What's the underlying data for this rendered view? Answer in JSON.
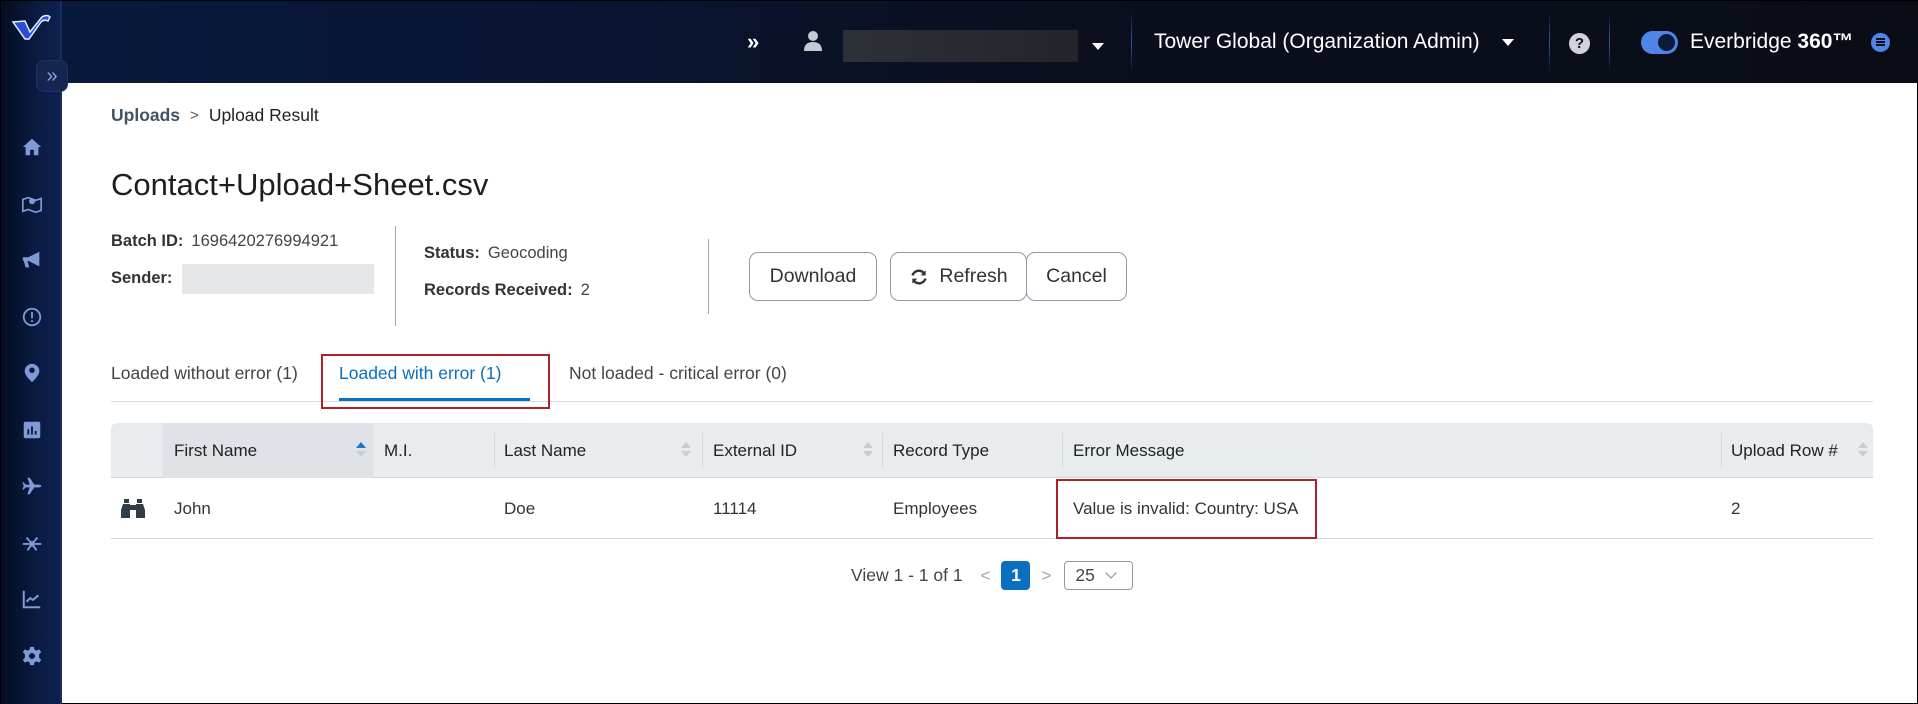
{
  "header": {
    "more_icon": "double-chevron-right",
    "user_name": "",
    "organization": "Tower Global (Organization Admin)",
    "product_name": "Everbridge",
    "product_suffix": "360™",
    "toggle_on": true
  },
  "sidebar": {
    "items": [
      {
        "name": "home",
        "icon": "home-icon"
      },
      {
        "name": "map",
        "icon": "map-icon"
      },
      {
        "name": "notifications",
        "icon": "megaphone-icon"
      },
      {
        "name": "incidents",
        "icon": "alert-circle-icon"
      },
      {
        "name": "locations",
        "icon": "map-pin-icon"
      },
      {
        "name": "reports",
        "icon": "bar-chart-icon"
      },
      {
        "name": "travel",
        "icon": "airplane-icon"
      },
      {
        "name": "integrations",
        "icon": "network-icon"
      },
      {
        "name": "analytics",
        "icon": "line-chart-icon"
      },
      {
        "name": "settings",
        "icon": "gear-icon"
      }
    ]
  },
  "breadcrumb": {
    "parent": "Uploads",
    "separator": ">",
    "current": "Upload Result"
  },
  "page_title": "Contact+Upload+Sheet.csv",
  "info": {
    "batch_id_label": "Batch ID:",
    "batch_id": "1696420276994921",
    "sender_label": "Sender:",
    "sender": "",
    "status_label": "Status:",
    "status": "Geocoding",
    "records_label": "Records Received:",
    "records": "2"
  },
  "actions": {
    "download": "Download",
    "refresh": "Refresh",
    "cancel": "Cancel"
  },
  "tabs": [
    {
      "label": "Loaded without error (1)",
      "active": false
    },
    {
      "label": "Loaded with error (1)",
      "active": true
    },
    {
      "label": "Not loaded - critical error (0)",
      "active": false
    }
  ],
  "table": {
    "columns": [
      "",
      "First Name",
      "M.I.",
      "Last Name",
      "External ID",
      "Record Type",
      "Error Message",
      "Upload Row #"
    ],
    "rows": [
      {
        "icon": "binoculars-icon",
        "first_name": "John",
        "mi": "",
        "last_name": "Doe",
        "external_id": "11114",
        "record_type": "Employees",
        "error_message": "Value is invalid: Country: USA",
        "upload_row": "2"
      }
    ]
  },
  "pagination": {
    "summary": "View 1 - 1 of 1",
    "prev": "<",
    "current_page": "1",
    "next": ">",
    "page_size": "25"
  }
}
